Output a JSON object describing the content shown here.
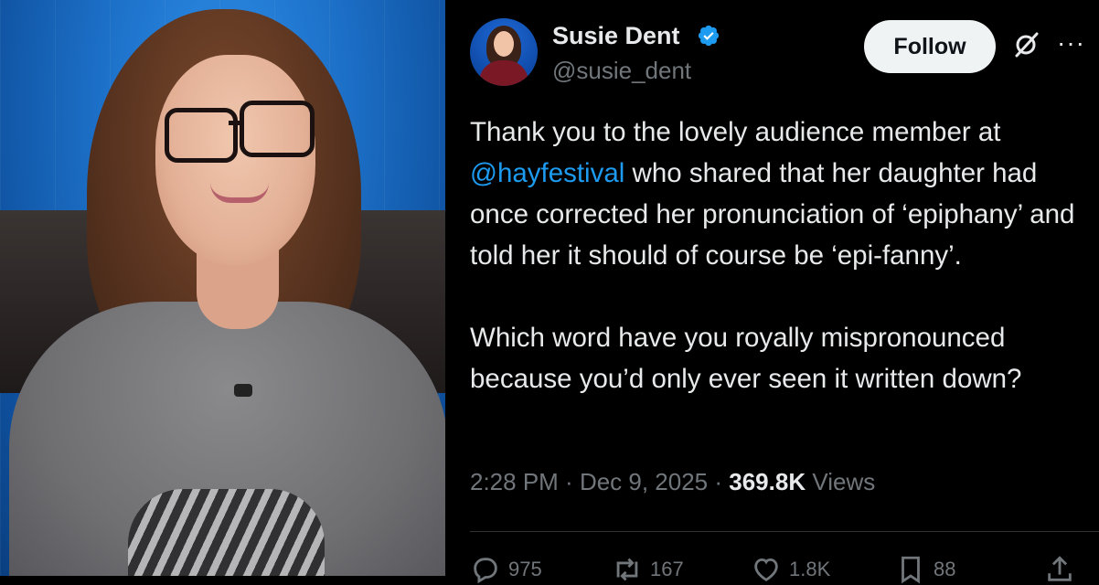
{
  "photo": {
    "subject": "woman-with-glasses-photo"
  },
  "tweet": {
    "author": {
      "name": "Susie Dent",
      "handle": "@susie_dent",
      "verified": true
    },
    "follow_label": "Follow",
    "text": {
      "line1_before": "Thank you to the lovely audience member at",
      "mention": "@hayfestival",
      "line2_after": " who shared that her daughter had once corrected her pronunciation of ‘epiphany’ and told her it should of course be ‘epi-fanny’.",
      "paragraph2": "Which word have you royally mispronounced because you’d only ever seen it written down?"
    },
    "meta": {
      "time": "2:28 PM",
      "sep1": " · ",
      "date": "Dec 9, 2025",
      "sep2": " · ",
      "views_count": "369.8K",
      "views_label": " Views"
    },
    "actions": {
      "replies": "975",
      "reposts": "167",
      "likes": "1.8K",
      "bookmarks": "88"
    }
  },
  "colors": {
    "background": "#000000",
    "text": "#e7e9ea",
    "secondary": "#71767b",
    "link": "#1d9bf0",
    "verified": "#1d9bf0",
    "follow_bg": "#eff3f4"
  },
  "icons": [
    "verified-badge-icon",
    "grok-icon",
    "more-icon",
    "reply-icon",
    "repost-icon",
    "like-icon",
    "bookmark-icon",
    "share-icon"
  ]
}
